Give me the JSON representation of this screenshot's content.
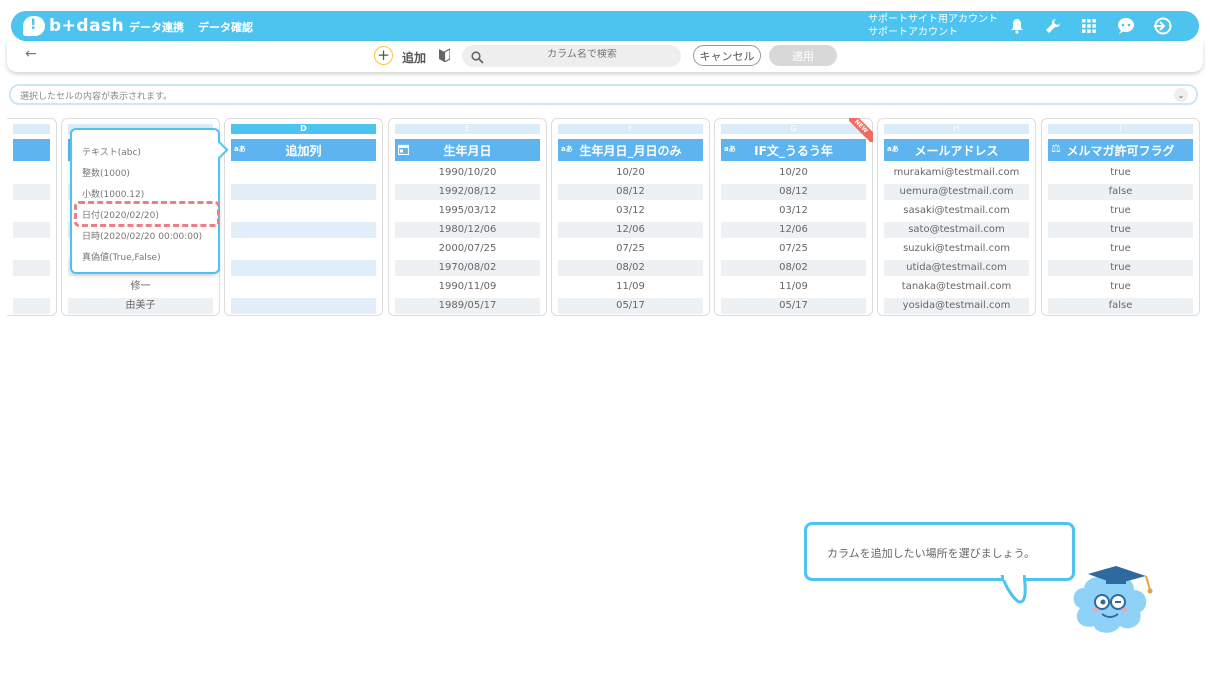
{
  "app": {
    "logo_text": "b+dash"
  },
  "nav": [
    {
      "label": "データ連携"
    },
    {
      "label": "データ確認"
    }
  ],
  "account": {
    "line1": "サポートサイト用アカウント",
    "line2": "サポートアカウント"
  },
  "toolbar": {
    "add_label": "追加",
    "search_placeholder": "カラム名で検索",
    "cancel_label": "キャンセル",
    "apply_label": "適用"
  },
  "cellbar": {
    "text": "選択したセルの内容が表示されます。"
  },
  "dropdown": {
    "options": [
      "テキスト(abc)",
      "整数(1000)",
      "小数(1000.12)",
      "日付(2020/02/20)",
      "日時(2020/02/20 00:00:00)",
      "真偽値(True,False)"
    ],
    "highlighted": "日付(2020/02/20)"
  },
  "columns": [
    {
      "letter": "",
      "header": "",
      "rows": [
        "",
        "",
        "",
        "",
        "",
        "",
        "",
        ""
      ]
    },
    {
      "letter": "",
      "header": "",
      "rows": [
        "",
        "",
        "",
        "",
        "",
        "",
        "修一",
        "由美子"
      ]
    },
    {
      "letter": "D",
      "header": "追加列",
      "rows": [
        "",
        "",
        "",
        "",
        "",
        "",
        "",
        ""
      ]
    },
    {
      "letter": "E",
      "header": "生年月日",
      "rows": [
        "1990/10/20",
        "1992/08/12",
        "1995/03/12",
        "1980/12/06",
        "2000/07/25",
        "1970/08/02",
        "1990/11/09",
        "1989/05/17"
      ]
    },
    {
      "letter": "F",
      "header": "生年月日_月日のみ",
      "rows": [
        "10/20",
        "08/12",
        "03/12",
        "12/06",
        "07/25",
        "08/02",
        "11/09",
        "05/17"
      ]
    },
    {
      "letter": "G",
      "header": "IF文_うるう年",
      "new_badge": "NEW",
      "rows": [
        "10/20",
        "08/12",
        "03/12",
        "12/06",
        "07/25",
        "08/02",
        "11/09",
        "05/17"
      ]
    },
    {
      "letter": "H",
      "header": "メールアドレス",
      "rows": [
        "murakami@testmail.com",
        "uemura@testmail.com",
        "sasaki@testmail.com",
        "sato@testmail.com",
        "suzuki@testmail.com",
        "utida@testmail.com",
        "tanaka@testmail.com",
        "yosida@testmail.com"
      ]
    },
    {
      "letter": "I",
      "header": "メルマガ許可フラグ",
      "rows": [
        "true",
        "false",
        "true",
        "true",
        "true",
        "true",
        "true",
        "false"
      ]
    }
  ],
  "type_labels": {
    "text": "aあ"
  },
  "tooltip": {
    "text": "カラムを追加したい場所を選びましょう。"
  },
  "colors": {
    "accent": "#4dc3f0",
    "header": "#5eb4ee",
    "highlight": "#ee7d86",
    "new_badge": "#f26b5e"
  }
}
